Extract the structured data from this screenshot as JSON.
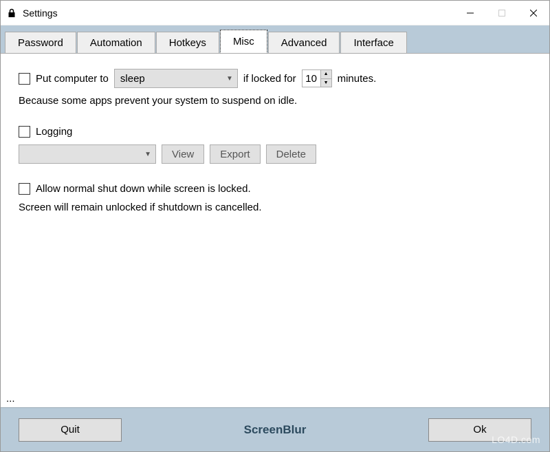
{
  "window": {
    "title": "Settings"
  },
  "tabs": [
    {
      "label": "Password"
    },
    {
      "label": "Automation"
    },
    {
      "label": "Hotkeys"
    },
    {
      "label": "Misc"
    },
    {
      "label": "Advanced"
    },
    {
      "label": "Interface"
    }
  ],
  "misc": {
    "put_computer_label": "Put computer to",
    "put_computer_action": "sleep",
    "if_locked_label": "if locked for",
    "if_locked_value": "10",
    "minutes_label": "minutes.",
    "put_computer_hint": "Because some apps prevent your system to suspend on idle.",
    "logging_label": "Logging",
    "logging_select": "",
    "view_btn": "View",
    "export_btn": "Export",
    "delete_btn": "Delete",
    "allow_shutdown_label": "Allow normal shut down while screen is locked.",
    "allow_shutdown_hint": "Screen will remain unlocked if shutdown is cancelled.",
    "ellipsis": "..."
  },
  "footer": {
    "quit": "Quit",
    "brand": "ScreenBlur",
    "ok": "Ok"
  },
  "watermark": "LO4D.com"
}
